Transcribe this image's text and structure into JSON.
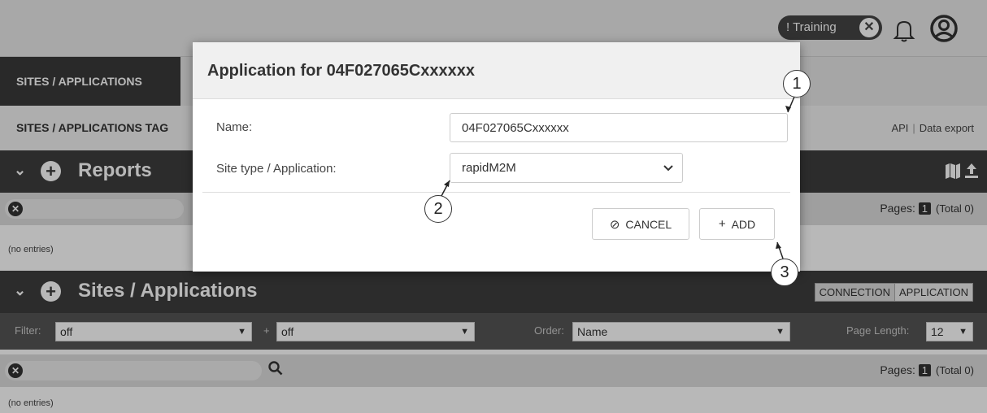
{
  "topbar": {
    "training_label": "! Training",
    "training_close_symbol": "✕"
  },
  "tabs": {
    "active_label": "SITES / APPLICATIONS"
  },
  "subnav": {
    "title": "SITES / APPLICATIONS TAG",
    "api_link": "API",
    "separator": "|",
    "data_export_link": "Data export"
  },
  "reports": {
    "title": "Reports",
    "pages_label": "Pages:",
    "page_number": "1",
    "total": "(Total 0)",
    "empty_text": "(no entries)"
  },
  "sites": {
    "title": "Sites / Applications",
    "view_toggle": [
      "CONNECTION",
      "APPLICATION"
    ],
    "filter_label": "Filter:",
    "filter_value": "off",
    "plus_label": "+",
    "filter2_value": "off",
    "order_label": "Order:",
    "order_value": "Name",
    "page_length_label": "Page Length:",
    "page_length_value": "12",
    "pages_label": "Pages:",
    "page_number": "1",
    "total": "(Total 0)",
    "empty_text": "(no entries)"
  },
  "modal": {
    "title": "Application for 04F027065Cxxxxxx",
    "name_label": "Name:",
    "name_value": "04F027065Cxxxxxx",
    "type_label": "Site type / Application:",
    "type_value": "rapidM2M",
    "cancel_label": "CANCEL",
    "add_label": "ADD"
  },
  "callouts": [
    "1",
    "2",
    "3"
  ],
  "colors": {
    "header_dark": "#3d3d3d",
    "overlay": "rgba(0,0,0,0.28)"
  }
}
